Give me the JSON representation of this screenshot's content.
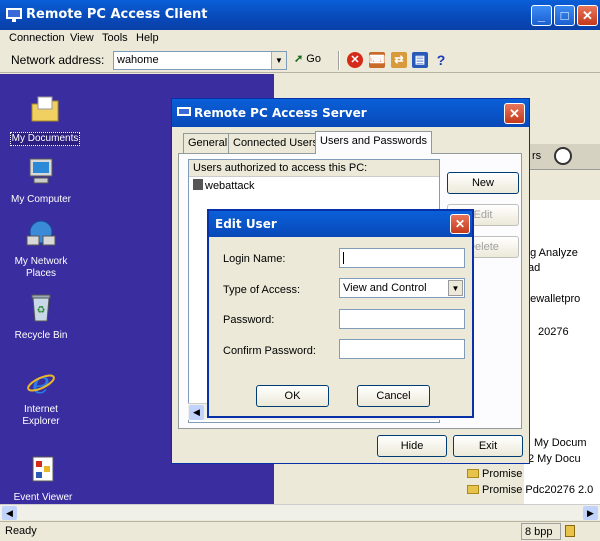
{
  "window": {
    "title": "Remote PC Access Client"
  },
  "menu": [
    "Connection",
    "View",
    "Tools",
    "Help"
  ],
  "toolbar": {
    "address_label": "Network address:",
    "address_value": "wahome",
    "go_label": "Go"
  },
  "desktop_icons": [
    {
      "label": "My Documents",
      "icon": "my-documents-icon"
    },
    {
      "label": "My Computer",
      "icon": "my-computer-icon"
    },
    {
      "label": "My Network Places",
      "icon": "network-places-icon"
    },
    {
      "label": "Recycle Bin",
      "icon": "recycle-bin-icon"
    },
    {
      "label": "Internet Explorer",
      "icon": "internet-explorer-icon"
    },
    {
      "label": "Event Viewer",
      "icon": "event-viewer-icon"
    }
  ],
  "background_window": {
    "panel_text": "rs",
    "items": [
      "og Analyze",
      "ad",
      "dewalletpro",
      "20276",
      "My Docum",
      "2 My Docu",
      "Promise",
      "Promise Pdc20276 2.0"
    ]
  },
  "server_dialog": {
    "title": "Remote PC Access Server",
    "tabs": [
      "General",
      "Connected Users",
      "Users and Passwords"
    ],
    "list_header": "Users authorized to access this PC:",
    "users": [
      "webattack"
    ],
    "new_label": "New",
    "edit_label": "Edit",
    "delete_label": "Delete",
    "hide_label": "Hide",
    "exit_label": "Exit"
  },
  "edit_user": {
    "title": "Edit User",
    "login_label": "Login Name:",
    "login_value": "",
    "access_label": "Type of Access:",
    "access_value": "View and Control",
    "password_label": "Password:",
    "confirm_label": "Confirm Password:",
    "ok_label": "OK",
    "cancel_label": "Cancel"
  },
  "status": {
    "text": "Ready",
    "color_depth": "8 bpp"
  }
}
